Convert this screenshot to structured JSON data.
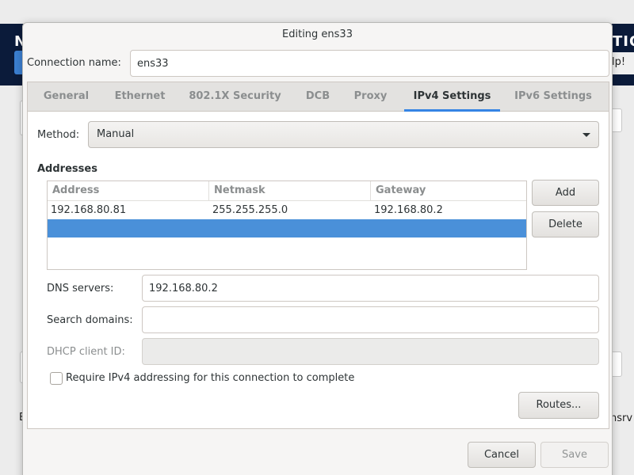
{
  "background": {
    "header_left": "N",
    "header_right": "TION",
    "help_label": "lp!",
    "footer_left": "E",
    "footer_right": "nsrv"
  },
  "dialog": {
    "title": "Editing ens33",
    "connection_name_label": "Connection name:",
    "connection_name_value": "ens33"
  },
  "tabs": [
    {
      "label": "General",
      "active": false
    },
    {
      "label": "Ethernet",
      "active": false
    },
    {
      "label": "802.1X Security",
      "active": false
    },
    {
      "label": "DCB",
      "active": false
    },
    {
      "label": "Proxy",
      "active": false
    },
    {
      "label": "IPv4 Settings",
      "active": true
    },
    {
      "label": "IPv6 Settings",
      "active": false
    }
  ],
  "ipv4": {
    "method_label": "Method:",
    "method_value": "Manual",
    "addresses_heading": "Addresses",
    "columns": [
      "Address",
      "Netmask",
      "Gateway"
    ],
    "rows": [
      [
        "192.168.80.81",
        "255.255.255.0",
        "192.168.80.2"
      ],
      [
        "",
        "",
        ""
      ]
    ],
    "selected_row": 1,
    "add_label": "Add",
    "delete_label": "Delete",
    "dns_label": "DNS servers:",
    "dns_value": "192.168.80.2",
    "search_label": "Search domains:",
    "search_value": "",
    "dhcp_label": "DHCP client ID:",
    "dhcp_value": "",
    "require_label": "Require IPv4 addressing for this connection to complete",
    "require_checked": false,
    "routes_label": "Routes..."
  },
  "footer": {
    "cancel_label": "Cancel",
    "save_label": "Save"
  },
  "colors": {
    "accent": "#3584e4",
    "selection": "#4a90d9"
  }
}
